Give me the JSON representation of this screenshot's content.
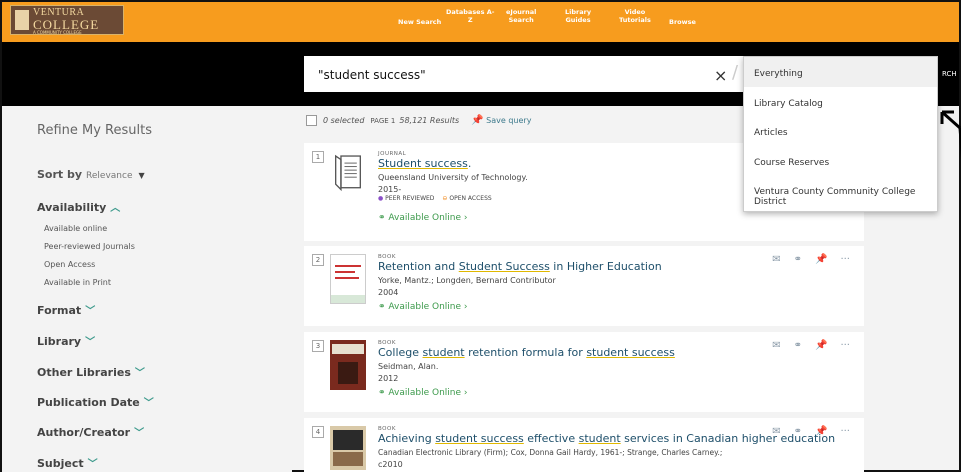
{
  "header": {
    "logo_top": "VENTURA",
    "logo_bottom": "COLLEGE",
    "logo_tagline": "A COMMUNITY COLLEGE",
    "nav": [
      {
        "label_lines": [
          "New Search"
        ]
      },
      {
        "label_lines": [
          "Databases A-",
          "Z"
        ]
      },
      {
        "label_lines": [
          "eJournal",
          "Search"
        ]
      },
      {
        "label_lines": [
          "Library",
          "Guides"
        ]
      },
      {
        "label_lines": [
          "Video",
          "Tutorials"
        ]
      },
      {
        "label_lines": [
          "Browse"
        ]
      }
    ]
  },
  "search": {
    "query": "\"student success\"",
    "clear_icon": "×",
    "scope_cut_label": "RCH"
  },
  "scope_dropdown": {
    "options": [
      "Everything",
      "Library Catalog",
      "Articles",
      "Course Reserves",
      "Ventura County Community College District"
    ],
    "selected": "Everything"
  },
  "sidebar": {
    "title": "Refine My Results",
    "sort_label": "Sort by",
    "sort_value": "Relevance",
    "availability_label": "Availability",
    "availability_items": [
      "Available online",
      "Peer-reviewed Journals",
      "Open Access",
      "Available in Print"
    ],
    "facets": [
      "Format",
      "Library",
      "Other Libraries",
      "Publication Date",
      "Author/Creator",
      "Subject"
    ]
  },
  "results_header": {
    "selected": "0 selected",
    "page": "PAGE 1",
    "count": "58,121 Results",
    "save_query": "Save query"
  },
  "results": [
    {
      "number": "1",
      "type": "JOURNAL",
      "title_parts": [
        {
          "t": "Student success",
          "u": true
        },
        {
          "t": ".",
          "u": false
        }
      ],
      "author": "Queensland University of Technology.",
      "year": "2015-",
      "badges": [
        "PEER REVIEWED",
        "OPEN ACCESS"
      ],
      "availability": "Available Online"
    },
    {
      "number": "2",
      "type": "BOOK",
      "title_parts": [
        {
          "t": "Retention and ",
          "u": false
        },
        {
          "t": "Student Success",
          "u": true
        },
        {
          "t": " in Higher Education",
          "u": false
        }
      ],
      "author": "Yorke, Mantz.; Longden, Bernard Contributor",
      "year": "2004",
      "availability": "Available Online"
    },
    {
      "number": "3",
      "type": "BOOK",
      "title_parts": [
        {
          "t": "College ",
          "u": false
        },
        {
          "t": "student",
          "u": true
        },
        {
          "t": " retention formula for ",
          "u": false
        },
        {
          "t": "student success",
          "u": true
        }
      ],
      "author": "Seidman, Alan.",
      "year": "2012",
      "availability": "Available Online"
    },
    {
      "number": "4",
      "type": "BOOK",
      "title_parts": [
        {
          "t": "Achieving ",
          "u": false
        },
        {
          "t": "student success",
          "u": true
        },
        {
          "t": " effective ",
          "u": false
        },
        {
          "t": "student",
          "u": true
        },
        {
          "t": " services in Canadian higher education",
          "u": false
        }
      ],
      "author": "Canadian Electronic Library (Firm); Cox, Donna Gail Hardy, 1961-; Strange, Charles Carney.;",
      "year": "c2010"
    }
  ],
  "colors": {
    "topbar": "#f79c1e",
    "searchbar": "#000000",
    "link": "#1e4f6a",
    "available": "#3d9a4c",
    "accent": "#3d9a8c"
  }
}
